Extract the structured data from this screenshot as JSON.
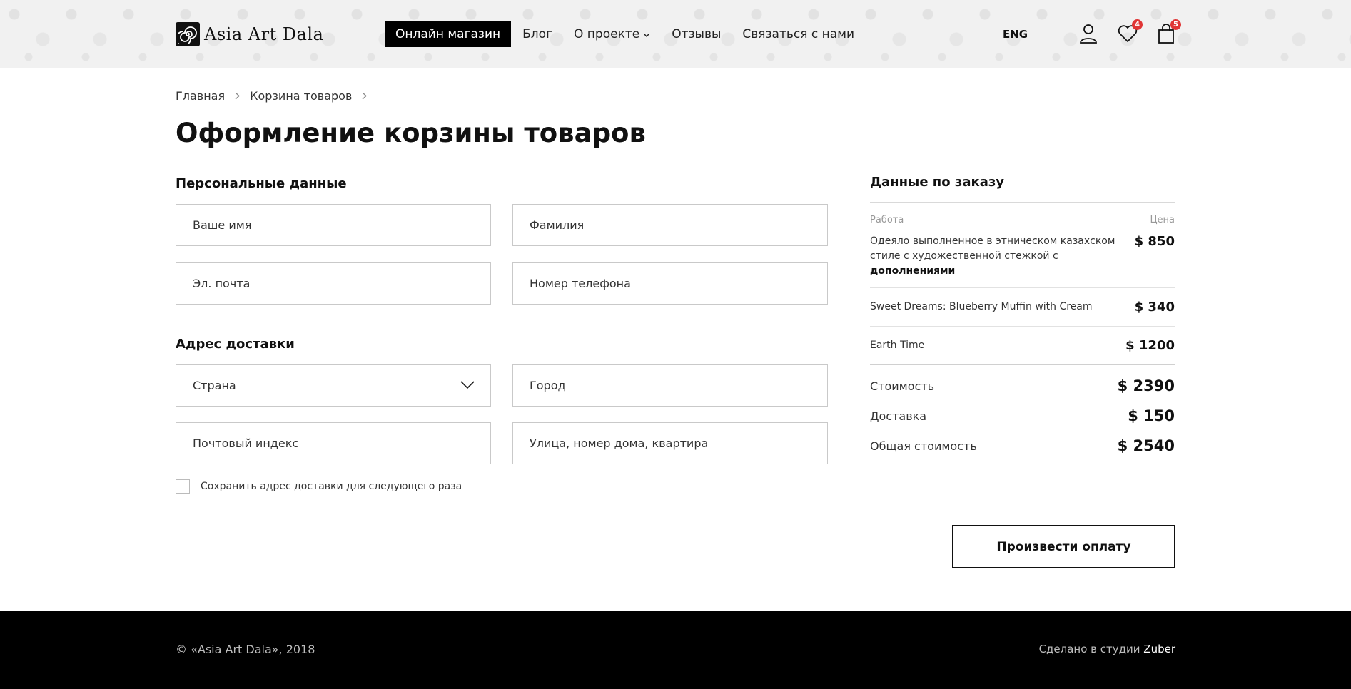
{
  "header": {
    "logo_text": "Asia Art Dala",
    "nav": [
      {
        "label": "Онлайн магазин"
      },
      {
        "label": "Блог"
      },
      {
        "label": "О проекте"
      },
      {
        "label": "Отзывы"
      },
      {
        "label": "Связаться с нами"
      }
    ],
    "lang": "ENG",
    "wishlist_count": "4",
    "cart_count": "5"
  },
  "breadcrumb": [
    "Главная",
    "Корзина товаров"
  ],
  "page_title": "Оформление корзины товаров",
  "personal": {
    "title": "Персональные данные",
    "first_name_placeholder": "Ваше имя",
    "last_name_placeholder": "Фамилия",
    "email_placeholder": "Эл. почта",
    "phone_placeholder": "Номер телефона"
  },
  "delivery": {
    "title": "Адрес доставки",
    "country_select": "Страна",
    "city_placeholder": "Город",
    "zip_placeholder": "Почтовый индекс",
    "street_placeholder": "Улица, номер дома, квартира",
    "save_label": "Сохранить адрес доставки для следующего раза"
  },
  "order": {
    "title": "Данные по заказу",
    "col_work": "Работа",
    "col_price": "Цена",
    "items": [
      {
        "name": "Одеяло выполненное в этническом казахском стиле с художественной стежкой с",
        "more": "дополнениями",
        "price": "$ 850"
      },
      {
        "name": "Sweet Dreams: Blueberry Muffin with Cream",
        "price": "$ 340"
      },
      {
        "name": "Earth Time",
        "price": "$ 1200"
      }
    ],
    "subtotal_label": "Стоимость",
    "subtotal": "$ 2390",
    "shipping_label": "Доставка",
    "shipping": "$ 150",
    "total_label": "Общая стоимость",
    "total": "$ 2540"
  },
  "pay_button": "Произвести оплату",
  "footer": {
    "copyright": "© «Asia Art Dala», 2018",
    "made_by": "Сделано в студии",
    "studio": "Zuber"
  },
  "colors": {
    "accent": "#000000",
    "badge": "#e03535",
    "footer_bg": "#000000"
  }
}
